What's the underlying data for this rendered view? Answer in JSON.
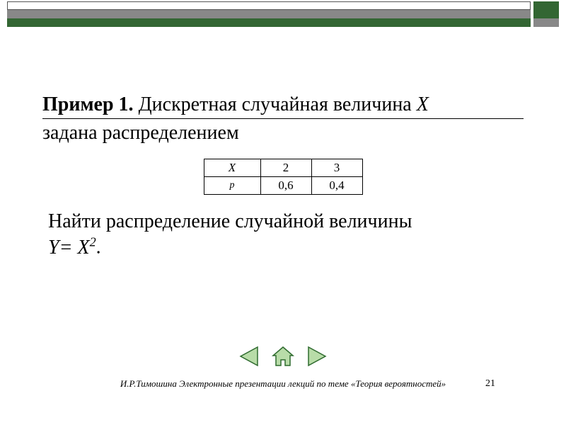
{
  "colors": {
    "accent_green": "#336633",
    "accent_grey": "#888888",
    "nav_fill": "#b8dca8",
    "nav_stroke": "#2f6b2f"
  },
  "title": {
    "label": "Пример 1.",
    "line1_rest_a": " Дискретная случайная величина ",
    "line1_var": "X",
    "line2": "задана распределением"
  },
  "table": {
    "row_header_x": "X",
    "row_header_p": "p",
    "x_values": [
      "2",
      "3"
    ],
    "p_values": [
      "0,6",
      "0,4"
    ]
  },
  "task": {
    "prefix": "Найти распределение случайной величины",
    "eq_lhs": "Y= X",
    "eq_exp": "2",
    "eq_suffix": "."
  },
  "nav": {
    "prev": "previous-slide",
    "home": "home",
    "next": "next-slide"
  },
  "footer": "И.Р.Тимошина Электронные презентации лекций по теме «Теория вероятностей»",
  "page": "21"
}
